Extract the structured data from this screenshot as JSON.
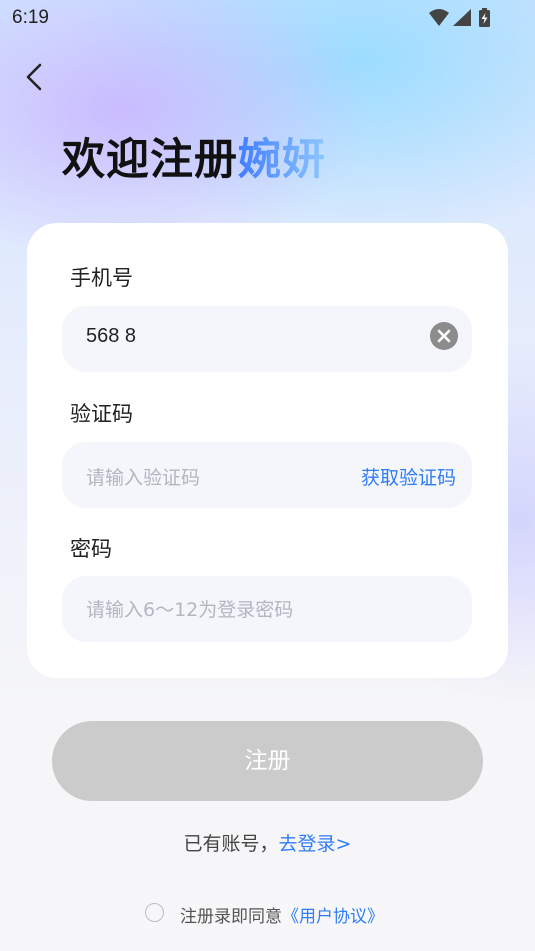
{
  "status_bar": {
    "time": "6:19",
    "icons": [
      "wifi-icon",
      "signal-icon",
      "battery-charging-icon"
    ]
  },
  "header": {
    "title_main": "欢迎注册",
    "title_brand": "婉妍"
  },
  "form": {
    "phone": {
      "label": "手机号",
      "value": "568 8"
    },
    "code": {
      "label": "验证码",
      "placeholder": "请输入验证码",
      "get_code_label": "获取验证码"
    },
    "password": {
      "label": "密码",
      "placeholder": "请输入6～12为登录密码"
    }
  },
  "submit_label": "注册",
  "login_prompt": {
    "text": "已有账号，",
    "link": "去登录>"
  },
  "agreement": {
    "text": "注册录即同意",
    "link": "《用户协议》"
  },
  "colors": {
    "accent": "#2f7df6",
    "submit_disabled": "#cbcbcb",
    "field_bg": "#f4f6fc"
  }
}
